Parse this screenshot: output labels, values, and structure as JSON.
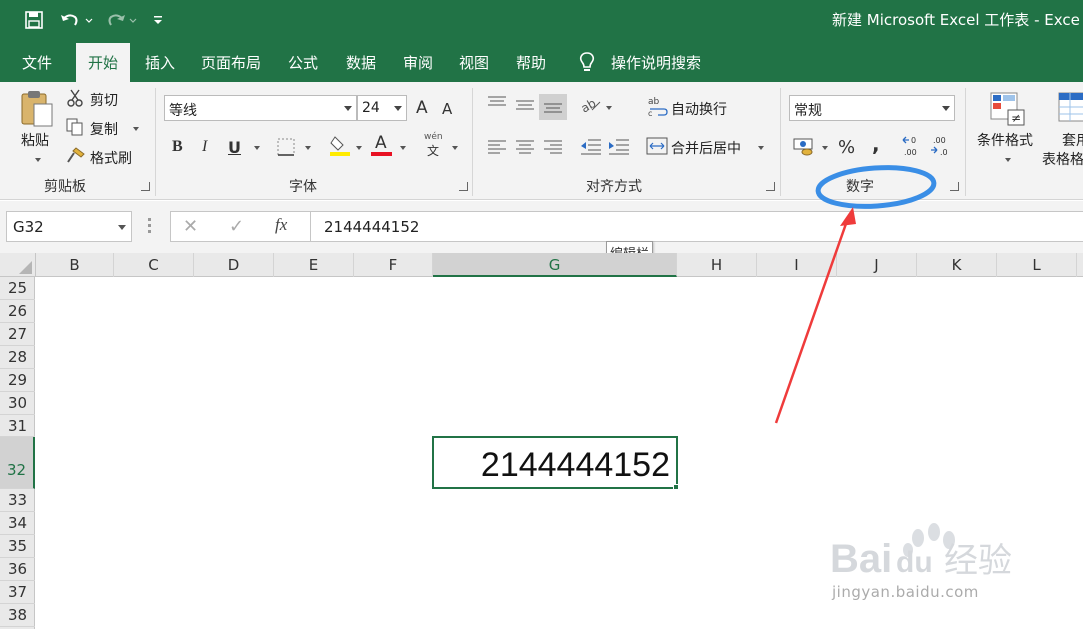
{
  "window": {
    "title": "新建 Microsoft Excel 工作表 - Exce",
    "accent": "#217346"
  },
  "qat": {
    "save_icon": "save-icon",
    "undo_icon": "undo-icon",
    "redo_icon": "redo-icon",
    "customize_icon": "customize-qat-icon"
  },
  "tabs": [
    {
      "label": "文件"
    },
    {
      "label": "开始"
    },
    {
      "label": "插入"
    },
    {
      "label": "页面布局"
    },
    {
      "label": "公式"
    },
    {
      "label": "数据"
    },
    {
      "label": "审阅"
    },
    {
      "label": "视图"
    },
    {
      "label": "帮助"
    },
    {
      "label": "操作说明搜索"
    }
  ],
  "ribbon": {
    "clipboard": {
      "paste": "粘贴",
      "cut": "剪切",
      "copy": "复制",
      "format_painter": "格式刷",
      "group_label": "剪贴板"
    },
    "font": {
      "name": "等线",
      "size": "24",
      "group_label": "字体",
      "bold": "B",
      "italic": "I",
      "underline": "U",
      "grow": "A",
      "shrink": "A",
      "font_color": "A",
      "phonetic": "wén",
      "phonetic_char": "文"
    },
    "alignment": {
      "wrap_text": "自动换行",
      "merge_center": "合并后居中",
      "group_label": "对齐方式"
    },
    "number": {
      "format": "常规",
      "percent": "%",
      "comma": ",",
      "group_label": "数字"
    },
    "styles": {
      "conditional_formatting": "条件格式",
      "format_as_table_1": "套用",
      "format_as_table_2": "表格格"
    }
  },
  "formula_bar": {
    "name_box": "G32",
    "cancel": "✕",
    "enter": "✓",
    "fx": "fx",
    "content": "2144444152",
    "tooltip": "编辑栏"
  },
  "grid": {
    "columns": [
      "B",
      "C",
      "D",
      "E",
      "F",
      "G",
      "H",
      "I",
      "J",
      "K",
      "L"
    ],
    "selected_column": "G",
    "rows": [
      "25",
      "26",
      "27",
      "28",
      "29",
      "30",
      "31",
      "32",
      "33",
      "34",
      "35",
      "36",
      "37",
      "38"
    ],
    "selected_row": "32",
    "active_cell_value": "2144444152"
  },
  "annotations": {
    "circle_color": "#3a8ee6",
    "arrow_color": "#ef3b3b"
  },
  "watermark": {
    "brand": "Baidu经验",
    "url": "jingyan.baidu.com"
  }
}
